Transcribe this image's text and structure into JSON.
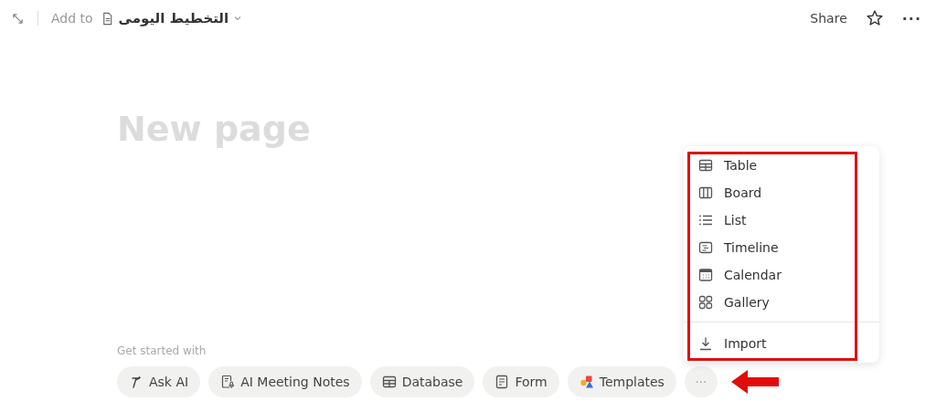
{
  "topbar": {
    "add_to": "Add to",
    "page_title": "التخطيط اليومى",
    "share": "Share",
    "more": "···"
  },
  "page": {
    "title_placeholder": "New page"
  },
  "get_started": {
    "label": "Get started with",
    "chips": [
      {
        "label": "Ask AI"
      },
      {
        "label": "AI Meeting Notes"
      },
      {
        "label": "Database"
      },
      {
        "label": "Form"
      },
      {
        "label": "Templates"
      }
    ],
    "more": "···"
  },
  "menu": {
    "items": [
      {
        "label": "Table"
      },
      {
        "label": "Board"
      },
      {
        "label": "List"
      },
      {
        "label": "Timeline"
      },
      {
        "label": "Calendar"
      },
      {
        "label": "Gallery"
      }
    ],
    "footer_item": {
      "label": "Import"
    }
  }
}
